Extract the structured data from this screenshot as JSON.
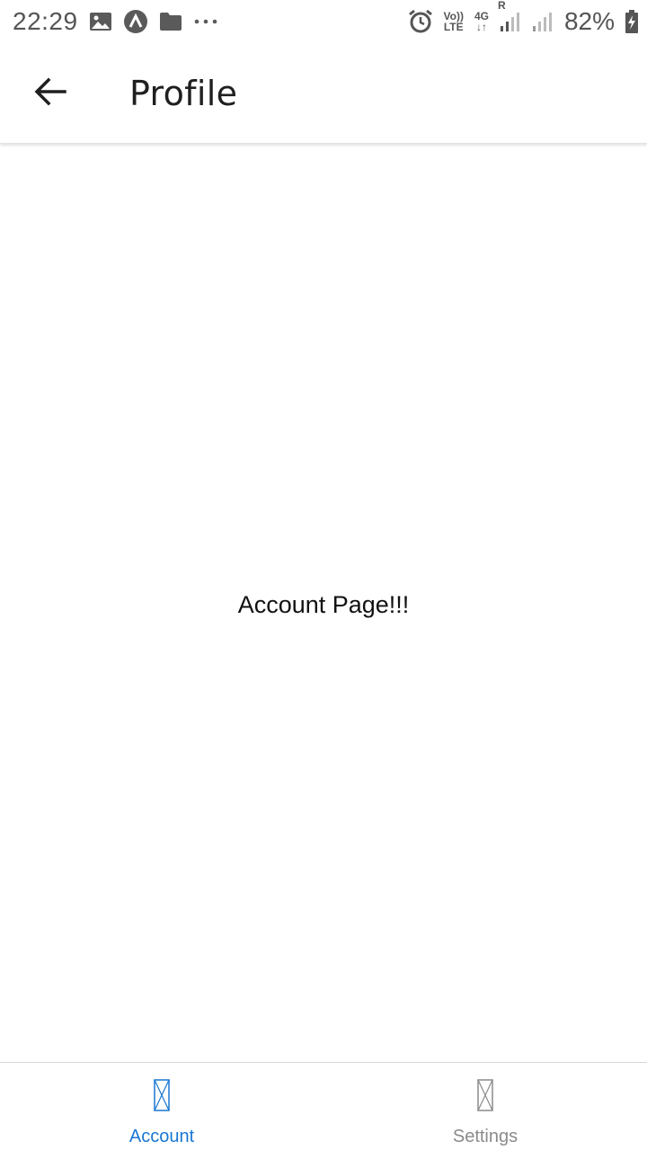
{
  "status_bar": {
    "time": "22:29",
    "left_icons": [
      "image-icon",
      "app-icon",
      "folder-icon",
      "more-dots-icon"
    ],
    "right_icons": [
      "alarm-icon",
      "volte-icon",
      "4g-icon",
      "signal-roaming-icon",
      "signal-icon",
      "battery-charging-icon"
    ],
    "volte_line1": "Vo))",
    "volte_line2": "LTE",
    "net_type": "4G",
    "roaming": "R",
    "battery": "82%"
  },
  "app_bar": {
    "back_icon": "arrow-left-icon",
    "title": "Profile"
  },
  "content": {
    "text": "Account Page!!!"
  },
  "tabs": [
    {
      "label": "Account",
      "icon": "missing-glyph-icon",
      "active": true,
      "color": "#1976d2"
    },
    {
      "label": "Settings",
      "icon": "missing-glyph-icon",
      "active": false,
      "color": "#8a8a8a"
    }
  ]
}
